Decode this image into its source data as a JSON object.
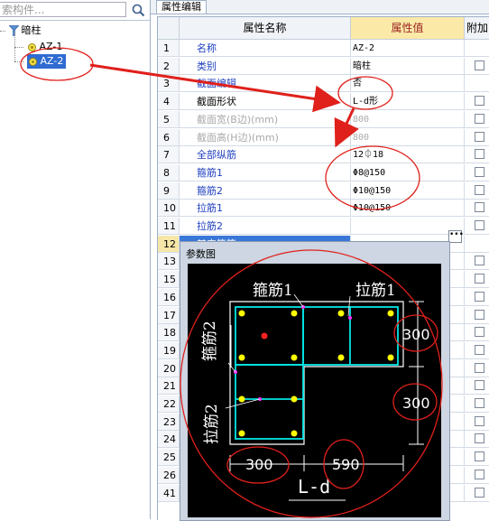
{
  "search": {
    "placeholder": "索构件..."
  },
  "tree": {
    "root": "暗柱",
    "items": [
      "AZ-1",
      "AZ-2"
    ],
    "selected_index": 1
  },
  "tab": "属性编辑",
  "grid": {
    "headers": {
      "name": "属性名称",
      "value": "属性值",
      "add": "附加"
    },
    "rows": [
      {
        "num": "1",
        "name": "名称",
        "value": "AZ-2",
        "style": "blue",
        "check": false
      },
      {
        "num": "2",
        "name": "类别",
        "value": "暗柱",
        "style": "blue",
        "check": true
      },
      {
        "num": "3",
        "name": "截面编辑",
        "value": "否",
        "style": "blue",
        "check": false
      },
      {
        "num": "4",
        "name": "截面形状",
        "value": "L-d形",
        "style": "black",
        "check": true
      },
      {
        "num": "5",
        "name": "截面宽(B边)(mm)",
        "value": "800",
        "style": "gray",
        "check": true
      },
      {
        "num": "6",
        "name": "截面高(H边)(mm)",
        "value": "800",
        "style": "gray",
        "check": true
      },
      {
        "num": "7",
        "name": "全部纵筋",
        "value": "12⏀18",
        "style": "blue",
        "check": true
      },
      {
        "num": "8",
        "name": "箍筋1",
        "value": "Φ8@150",
        "style": "blue",
        "check": true
      },
      {
        "num": "9",
        "name": "箍筋2",
        "value": "Φ10@150",
        "style": "blue",
        "check": true
      },
      {
        "num": "10",
        "name": "拉筋1",
        "value": "Φ10@150",
        "style": "blue",
        "check": true
      },
      {
        "num": "11",
        "name": "拉筋2",
        "value": "",
        "style": "blue",
        "check": true
      },
      {
        "num": "12",
        "name": "其它箍筋",
        "value": "",
        "style": "blue",
        "check": false
      },
      {
        "num": "13",
        "name": "",
        "value": "",
        "style": "blue",
        "check": true
      },
      {
        "num": "15",
        "name": "",
        "value": "",
        "style": "blue",
        "check": true
      },
      {
        "num": "16",
        "name": "",
        "value": "",
        "style": "blue",
        "check": true
      },
      {
        "num": "17",
        "name": "",
        "value": "",
        "style": "blue",
        "check": true
      },
      {
        "num": "18",
        "name": "",
        "value": "",
        "style": "blue",
        "check": true
      },
      {
        "num": "19",
        "name": "",
        "value": "",
        "style": "blue",
        "check": true
      },
      {
        "num": "20",
        "name": "",
        "value": "",
        "style": "blue",
        "check": true
      },
      {
        "num": "21",
        "name": "",
        "value": "",
        "style": "blue",
        "check": true
      },
      {
        "num": "22",
        "name": "",
        "value": "",
        "style": "blue",
        "check": true
      },
      {
        "num": "23",
        "name": "",
        "value": "",
        "style": "blue",
        "check": true
      },
      {
        "num": "24",
        "name": "",
        "value": "",
        "style": "blue",
        "check": true
      },
      {
        "num": "25",
        "name": "",
        "value": "",
        "style": "blue",
        "check": true
      },
      {
        "num": "26",
        "name": "",
        "value": "",
        "style": "blue",
        "check": true
      },
      {
        "num": "41",
        "name": "",
        "value": "",
        "style": "blue",
        "check": true
      }
    ]
  },
  "popup": {
    "title": "参数图",
    "labels": {
      "stirrup1": "箍筋1",
      "tie1": "拉筋1",
      "stirrup2": "箍筋2",
      "tie2": "拉筋2",
      "dim_right_top": "300",
      "dim_right_bottom": "300",
      "dim_bottom_left": "300",
      "dim_bottom_right": "590",
      "shape": "L-d"
    }
  },
  "colors": {
    "annotation": "#e0201b",
    "rebar": "#00e5e5",
    "bar_dot": "#ffff00",
    "highlight_row": "#3a78d8"
  }
}
